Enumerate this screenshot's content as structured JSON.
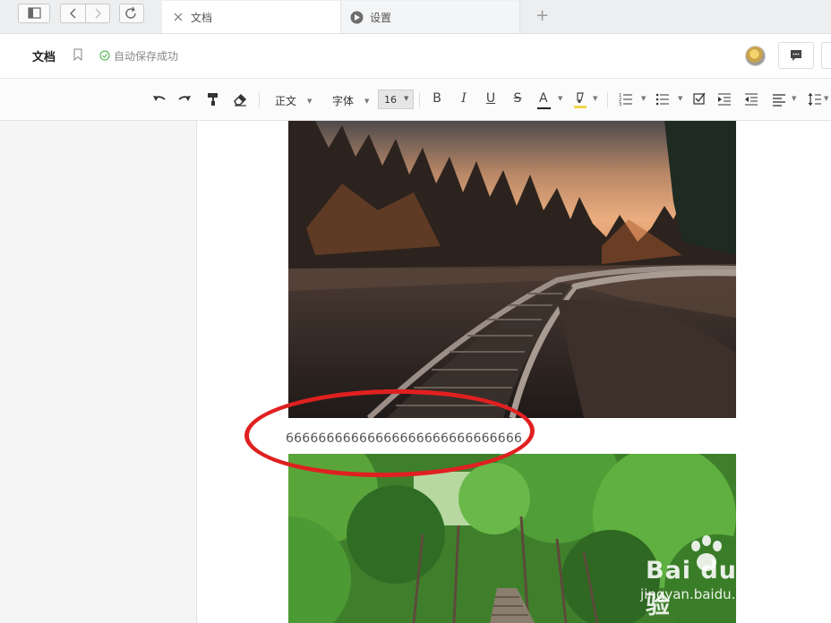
{
  "tabbar": {
    "tabs": [
      {
        "label": "文档",
        "active": true
      },
      {
        "label": "设置",
        "active": false
      }
    ],
    "new_tab_label": "+"
  },
  "docbar": {
    "title": "文档",
    "autosave": "自动保存成功"
  },
  "toolbar": {
    "paragraph_style": "正文",
    "font": "字体",
    "font_size": "16",
    "bold": "B",
    "italic": "I",
    "underline": "U",
    "strike": "S",
    "font_color": "A"
  },
  "content": {
    "text": "66666666666666666666666666666",
    "images": [
      "railway-photo",
      "forest-photo"
    ]
  },
  "watermark": {
    "text": "Bai du 经验",
    "sub": "jingyan.baidu.com"
  },
  "colors": {
    "annotation": "#e02020",
    "autosave_icon": "#5cb85c"
  }
}
